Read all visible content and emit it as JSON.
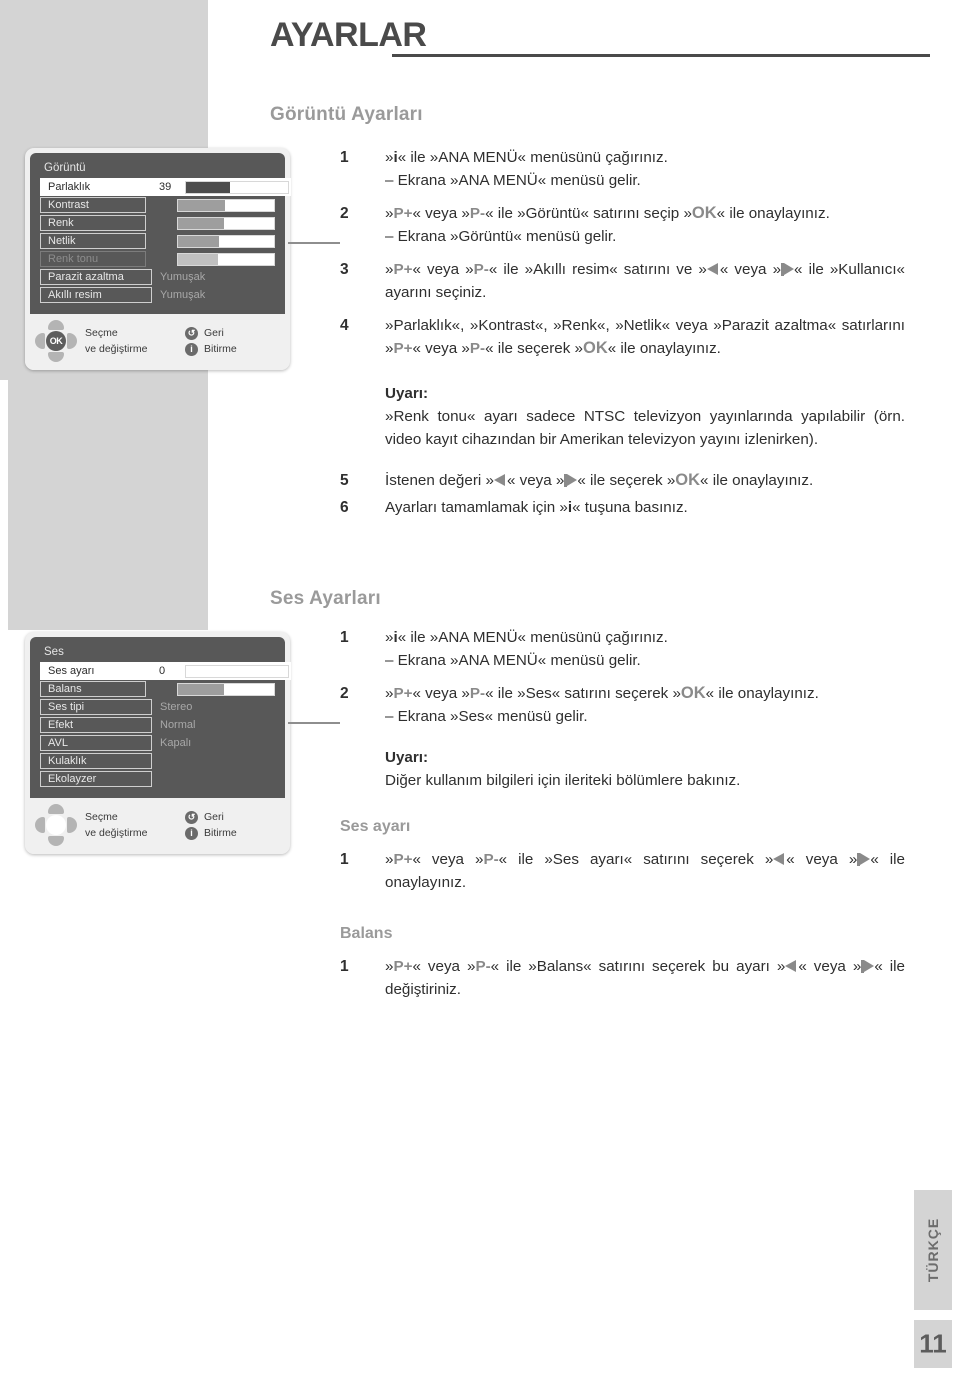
{
  "header": {
    "title": "AYARLAR"
  },
  "sections": {
    "picture_heading": "Görüntü Ayarları",
    "sound_heading": "Ses Ayarları",
    "sound_volume_heading": "Ses ayarı",
    "balance_heading": "Balans"
  },
  "picture_steps": {
    "s1_num": "1",
    "s1_a": "« ile »ANA MENÜ« menüsünü çağırınız.",
    "s1_sub": "– Ekrana »ANA MENÜ« menüsü gelir.",
    "s2_num": "2",
    "s2_a": "« veya »",
    "s2_b": "« ile »Görüntü« satırını seçip »",
    "s2_c": "« ile onaylayınız.",
    "s2_sub": "– Ekrana »Görüntü« menüsü gelir.",
    "s3_num": "3",
    "s3_a": "« veya »",
    "s3_b": "« ile »Akıllı resim« satırını ve »",
    "s3_c": "« veya »",
    "s3_d": "« ile »Kullanıcı« ayarını seçiniz.",
    "s4_num": "4",
    "s4_a": "»Parlaklık«, »Kontrast«, »Renk«, »Netlik« veya »Parazit azaltma« satırlarını »",
    "s4_b": "« veya »",
    "s4_c": "« ile seçerek »",
    "s4_d": "« ile onaylayınız.",
    "note_title": "Uyarı:",
    "note_body": "»Renk tonu« ayarı sadece NTSC televizyon yayınlarında yapılabilir (örn. video kayıt cihazından bir Amerikan televizyon yayını izlenirken).",
    "s5_num": "5",
    "s5_a": "İstenen değeri »",
    "s5_b": "« veya »",
    "s5_c": "« ile seçerek »",
    "s5_d": "« ile onaylayınız.",
    "s6_num": "6",
    "s6_a": "Ayarları tamamlamak için »",
    "s6_b": "« tuşuna basınız."
  },
  "sound_steps": {
    "s1_num": "1",
    "s1_a": "« ile »ANA MENÜ« menüsünü çağırınız.",
    "s1_sub": "– Ekrana »ANA MENÜ« menüsü gelir.",
    "s2_num": "2",
    "s2_a": "« veya »",
    "s2_b": "« ile »Ses« satırını seçerek »",
    "s2_c": "« ile onaylayınız.",
    "s2_sub": "– Ekrana »Ses« menüsü gelir.",
    "note_title": "Uyarı:",
    "note_body": "Diğer kullanım bilgileri için ileriteki bölümlere bakınız."
  },
  "volume_steps": {
    "s1_num": "1",
    "s1_a": "« veya »",
    "s1_b": "« ile »Ses ayarı« satırını seçerek »",
    "s1_c": "« veya »",
    "s1_d": "« ile onaylayınız."
  },
  "balance_steps": {
    "s1_num": "1",
    "s1_a": "« veya »",
    "s1_b": "« ile »Balans« satırını seçerek bu ayarı »",
    "s1_c": "« veya »",
    "s1_d": "« ile değiştiriniz."
  },
  "keys": {
    "info": "i",
    "p_plus": "P+",
    "p_minus": "P-",
    "ok": "OK"
  },
  "picture_osd": {
    "title": "Görüntü",
    "rows": [
      {
        "label": "Parlaklık",
        "value": "39",
        "bar": 43,
        "state": "selected"
      },
      {
        "label": "Kontrast",
        "value": "",
        "bar": 49,
        "state": "normal"
      },
      {
        "label": "Renk",
        "value": "",
        "bar": 48,
        "state": "normal"
      },
      {
        "label": "Netlik",
        "value": "",
        "bar": 43,
        "state": "normal"
      },
      {
        "label": "Renk tonu",
        "value": "",
        "bar": 42,
        "state": "dim"
      },
      {
        "label": "Parazit azaltma",
        "text": "Yumuşak",
        "state": "normal"
      },
      {
        "label": "Akıllı resim",
        "text": "Yumuşak",
        "state": "normal"
      }
    ],
    "footer": {
      "select_a": "Seçme",
      "select_b": "ve değiştirme",
      "back": "Geri",
      "back_icon": "↺",
      "finish": "Bitirme",
      "finish_icon": "i",
      "ok_label": "OK"
    }
  },
  "sound_osd": {
    "title": "Ses",
    "rows": [
      {
        "label": "Ses ayarı",
        "value": "0",
        "bar": 0,
        "state": "selected"
      },
      {
        "label": "Balans",
        "value": "",
        "bar": 48,
        "state": "normal"
      },
      {
        "label": "Ses tipi",
        "text": "Stereo",
        "state": "normal"
      },
      {
        "label": "Efekt",
        "text": "Normal",
        "state": "normal"
      },
      {
        "label": "AVL",
        "text": "Kapalı",
        "state": "normal"
      },
      {
        "label": "Kulaklık",
        "text": "",
        "state": "normal"
      },
      {
        "label": "Ekolayzer",
        "text": "",
        "state": "normal"
      }
    ],
    "footer": {
      "select_a": "Seçme",
      "select_b": "ve değiştirme",
      "back": "Geri",
      "back_icon": "↺",
      "finish": "Bitirme",
      "finish_icon": "i",
      "ok_label": ""
    }
  },
  "footer": {
    "language": "TÜRKÇE",
    "page": "11"
  },
  "colors": {
    "grey_panel": "#d4d4d4",
    "osd_body": "#585858",
    "osd_shell": "#f0f0f0",
    "heading_grey": "#9a9a9a",
    "text": "#2f2f2f"
  }
}
